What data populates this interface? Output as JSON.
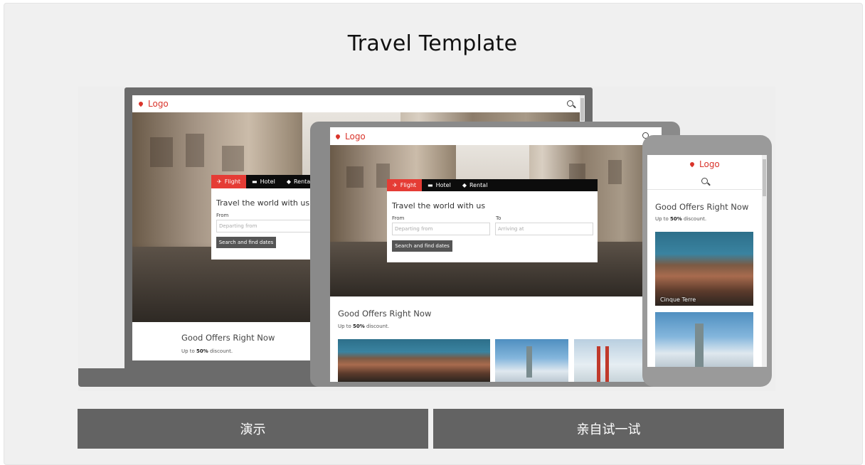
{
  "page": {
    "title": "Travel Template"
  },
  "preview": {
    "logo_text": "Logo",
    "booking_tabs": [
      "Flight",
      "Hotel",
      "Rental"
    ],
    "form": {
      "title": "Travel the world with us",
      "from_label": "From",
      "to_label": "To",
      "from_placeholder": "Departing from",
      "to_placeholder": "Arriving at",
      "search_button": "Search and find dates"
    },
    "offers": {
      "title": "Good Offers Right Now",
      "sub_prefix": "Up to ",
      "sub_bold": "50%",
      "sub_suffix": " discount."
    },
    "phone_photo_caption": "Cinque Terre"
  },
  "actions": {
    "demo_label": "演示",
    "try_label": "亲自试一试"
  },
  "colors": {
    "accent_red": "#e53c35",
    "device_gray": "#6b6b6b",
    "button_gray": "#636363",
    "panel_bg": "#f0f0f0"
  },
  "icons": [
    "map-pin-icon",
    "search-icon",
    "plane-icon",
    "bed-icon",
    "car-icon"
  ]
}
